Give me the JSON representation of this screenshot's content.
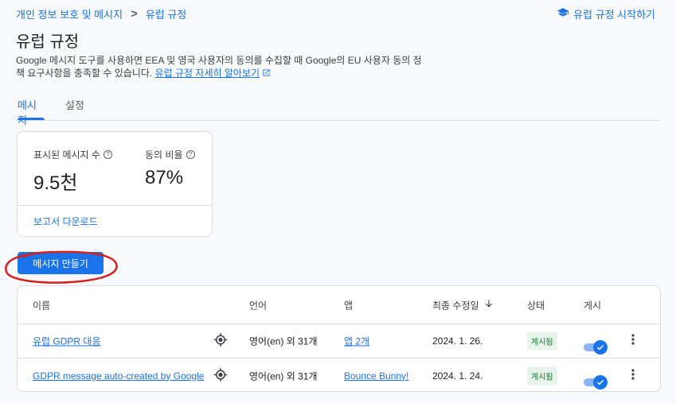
{
  "breadcrumb": {
    "parent": "개인 정보 보호 및 메시지",
    "separator": ">",
    "current": "유럽 규정"
  },
  "header": {
    "start_link": "유럽 규정 시작하기",
    "title": "유럽 규정",
    "description": "Google 메시지 도구를 사용하면 EEA 및 영국 사용자의 동의를 수집할 때 Google의 EU 사용자 동의 정책 요구사항을 충족할 수 있습니다.",
    "learn_more": "유럽 규정 자세히 알아보기"
  },
  "tabs": [
    {
      "label": "메시지",
      "active": true
    },
    {
      "label": "설정",
      "active": false
    }
  ],
  "stats": {
    "shown_label": "표시된 메시지 수",
    "shown_value": "9.5천",
    "consent_label": "동의 비율",
    "consent_value": "87%",
    "download": "보고서 다운로드"
  },
  "create_button": "메시지 만들기",
  "table": {
    "headers": {
      "name": "이름",
      "language": "언어",
      "app": "앱",
      "modified": "최종 수정일",
      "status": "상태",
      "publish": "게시"
    },
    "rows": [
      {
        "name": "유럽 GDPR 대응",
        "language": "영어(en) 외 31개",
        "app": "앱 2개",
        "modified": "2024. 1. 26.",
        "status": "게시됨",
        "published": true
      },
      {
        "name": "GDPR message auto-created by Google",
        "language": "영어(en) 외 31개",
        "app": "Bounce Bunny!",
        "modified": "2024. 1. 24.",
        "status": "게시됨",
        "published": true
      }
    ]
  },
  "colors": {
    "accent": "#1a73e8",
    "annotation": "#d62020",
    "badge_bg": "#e6f4ea",
    "badge_text": "#137333"
  },
  "icons": {
    "start_link": "school-icon",
    "external": "open-in-new-icon",
    "help": "help-circle-icon",
    "sort": "arrow-down-icon",
    "location": "my-location-icon",
    "more": "more-vert-icon"
  }
}
